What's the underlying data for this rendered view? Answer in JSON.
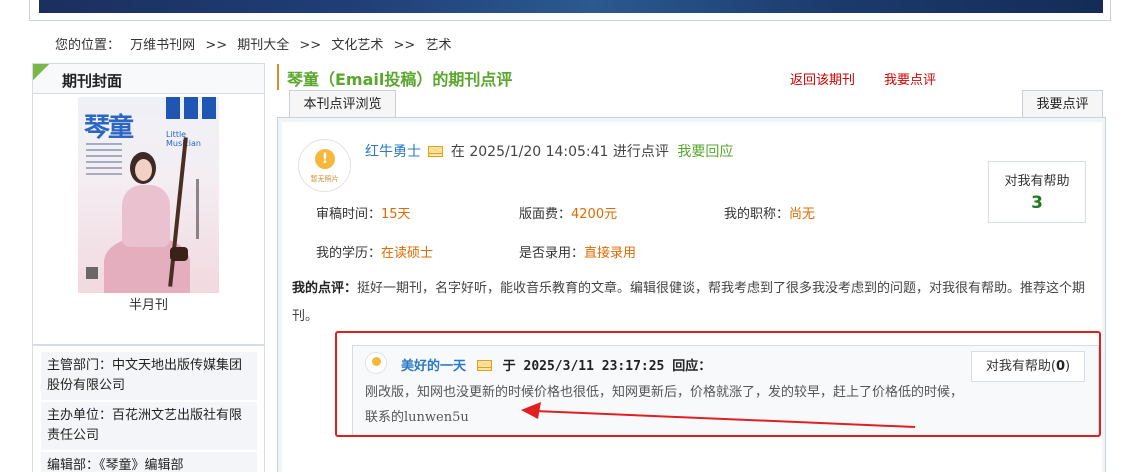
{
  "breadcrumb": {
    "prefix": "您的位置：",
    "items": [
      "万维书刊网",
      "期刊大全",
      "文化艺术",
      "艺术"
    ],
    "separator": ">>"
  },
  "cover": {
    "panel_title": "期刊封面",
    "magazine_title": "琴童",
    "magazine_sub": "Little Musician",
    "frequency": "半月刊"
  },
  "journal_info": [
    {
      "label": "主管部门：",
      "value": "中文天地出版传媒集团股份有限公司"
    },
    {
      "label": "主办单位：",
      "value": "百花洲文艺出版社有限责任公司"
    },
    {
      "label": "编辑部：",
      "value": "《琴童》编辑部"
    }
  ],
  "review_section": {
    "title": "琴童（Email投稿）的期刊点评",
    "back_link": "返回该期刊",
    "comment_link": "我要点评",
    "tab_browse": "本刊点评浏览",
    "tab_comment": "我要点评"
  },
  "review": {
    "avatar_caption": "暂无照片",
    "user": "红牛勇士",
    "mid_text": "在 2025/1/20 14:05:41 进行点评",
    "reply_link": "我要回应",
    "help_label": "对我有帮助",
    "help_count": "3",
    "fields": {
      "review_time_label": "审稿时间：",
      "review_time": "15天",
      "fee_label": "版面费：",
      "fee": "4200元",
      "title_label": "我的职称：",
      "title_value": "尚无",
      "edu_label": "我的学历：",
      "edu": "在读硕士",
      "accepted_label": "是否录用：",
      "accepted": "直接录用"
    },
    "comment_label": "我的点评：",
    "comment_text": "挺好一期刊，名字好听，能收音乐教育的文章。编辑很健谈，帮我考虑到了很多我没考虑到的问题，对我很有帮助。推荐这个期刊。"
  },
  "reply": {
    "user": "美好的一天",
    "mid": "于 2025/3/11 23:17:25 回应：",
    "text": "刚改版，知网也没更新的时候价格也很低，知网更新后，价格就涨了，发的较早，赶上了价格低的时候，联系的lunwen5u",
    "help_label": "对我有帮助(",
    "help_count": "0",
    "help_close": ")"
  },
  "colors": {
    "accent_green": "#5aa72e",
    "link_blue": "#2b78c5",
    "link_red": "#d40000",
    "value_orange": "#e06a00",
    "annotation_red": "#e02020"
  }
}
